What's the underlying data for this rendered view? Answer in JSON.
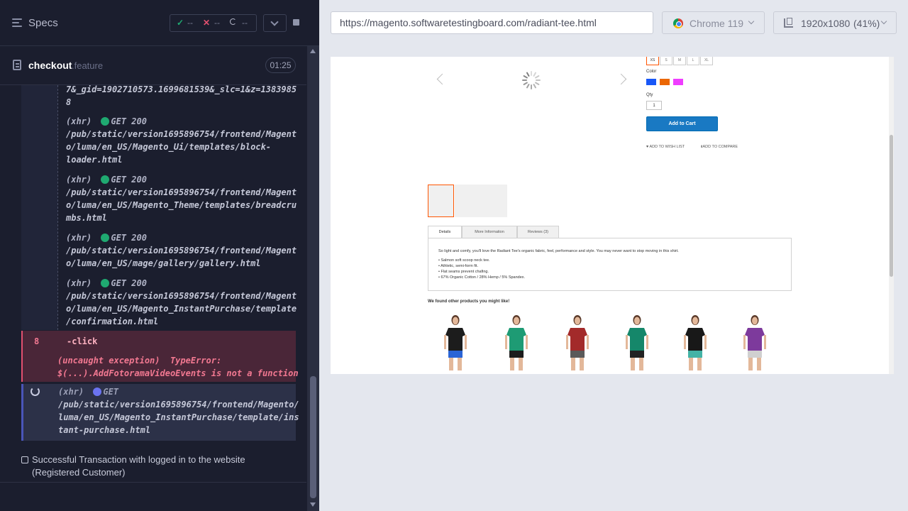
{
  "topbar": {
    "title": "Specs",
    "stats": {
      "passed": "--",
      "failed": "--",
      "pending": "--"
    }
  },
  "file": {
    "name": "checkout",
    "ext": ".feature",
    "duration": "01:25"
  },
  "log": {
    "partial_line": "7&_gid=1902710573.1699681539&_slc=1&z=1383985\n8",
    "entries": [
      {
        "type": "(xhr)",
        "method": "GET 200",
        "path": "/pub/static/version1695896754/frontend/Magent\no/luma/en_US/Magento_Ui/templates/block-\nloader.html"
      },
      {
        "type": "(xhr)",
        "method": "GET 200",
        "path": "/pub/static/version1695896754/frontend/Magent\no/luma/en_US/Magento_Theme/templates/breadcru\nmbs.html"
      },
      {
        "type": "(xhr)",
        "method": "GET 200",
        "path": "/pub/static/version1695896754/frontend/Magent\no/luma/en_US/mage/gallery/gallery.html"
      },
      {
        "type": "(xhr)",
        "method": "GET 200",
        "path": "/pub/static/version1695896754/frontend/Magent\no/luma/en_US/Magento_InstantPurchase/template\n/confirmation.html"
      }
    ],
    "error": {
      "number": "8",
      "command": "-click",
      "label": "(uncaught exception)",
      "type": "TypeError:",
      "message": "$(...).AddFotoramaVideoEvents is not a function"
    },
    "pending": {
      "type": "(xhr)",
      "method": "GET",
      "path": "/pub/static/version1695896754/frontend/Magento/\nluma/en_US/Magento_InstantPurchase/template/ins\ntant-purchase.html"
    },
    "test_title": "Successful Transaction with logged in to the website (Registered Customer)"
  },
  "browser": {
    "url": "https://magento.softwaretestingboard.com/radiant-tee.html",
    "name": "Chrome 119",
    "viewport": "1920x1080",
    "scale": "(41%)"
  },
  "aut": {
    "sizes": [
      "XS",
      "S",
      "M",
      "L",
      "XL"
    ],
    "color_label": "Color",
    "colors": [
      "#1857f7",
      "#eb6703",
      "#ef3dff"
    ],
    "qty_label": "Qty",
    "qty_value": "1",
    "add_to_cart": "Add to Cart",
    "wishlist": "ADD TO WISH LIST",
    "compare": "ADD TO COMPARE",
    "tabs": [
      "Details",
      "More Information",
      "Reviews (3)"
    ],
    "description": "So light and comfy, you'll love the Radiant Tee's organic fabric, feel, performance and style. You may never want to stop moving in this shirt.",
    "bullets": [
      "• Salmon soft scoop neck tee.",
      "• Athletic, semi-form fit.",
      "• Flat seams prevent chafing.",
      "• 67% Organic Cotton / 28% Hemp / 5% Spandex."
    ],
    "upsell_title": "We found other products you might like!",
    "products": [
      {
        "shirt": "#1c1c1c",
        "shorts": "#2a64d6"
      },
      {
        "shirt": "#1e9b74",
        "shorts": "#1c1c1c"
      },
      {
        "shirt": "#a32a2a",
        "shorts": "#5a5a5a"
      },
      {
        "shirt": "#15876a",
        "shorts": "#222222"
      },
      {
        "shirt": "#181818",
        "shorts": "#43b3a6"
      },
      {
        "shirt": "#7d3a9c",
        "shorts": "#d0d0d0"
      }
    ]
  }
}
